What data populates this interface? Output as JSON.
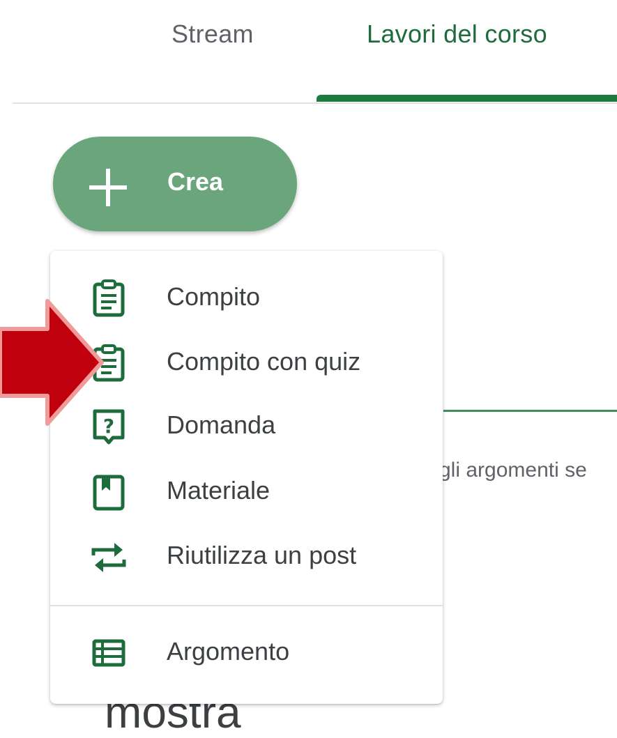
{
  "tabs": {
    "stream_label": "Stream",
    "classwork_label": "Lavori del corso"
  },
  "create_button": {
    "label": "Crea"
  },
  "background": {
    "partial_text": "gli argomenti se",
    "partial_bottom_text": "mostra"
  },
  "menu": {
    "items": [
      {
        "label": "Compito",
        "icon": "assignment-icon"
      },
      {
        "label": "Compito con quiz",
        "icon": "quiz-assignment-icon"
      },
      {
        "label": "Domanda",
        "icon": "question-icon"
      },
      {
        "label": "Materiale",
        "icon": "material-icon"
      },
      {
        "label": "Riutilizza un post",
        "icon": "reuse-post-icon"
      },
      {
        "label": "Argomento",
        "icon": "topic-icon"
      }
    ]
  },
  "colors": {
    "accent": "#1e7b3e",
    "create_button": "#6aa57c",
    "icon": "#1e6b3c",
    "annotation_arrow": "#c0000c"
  }
}
